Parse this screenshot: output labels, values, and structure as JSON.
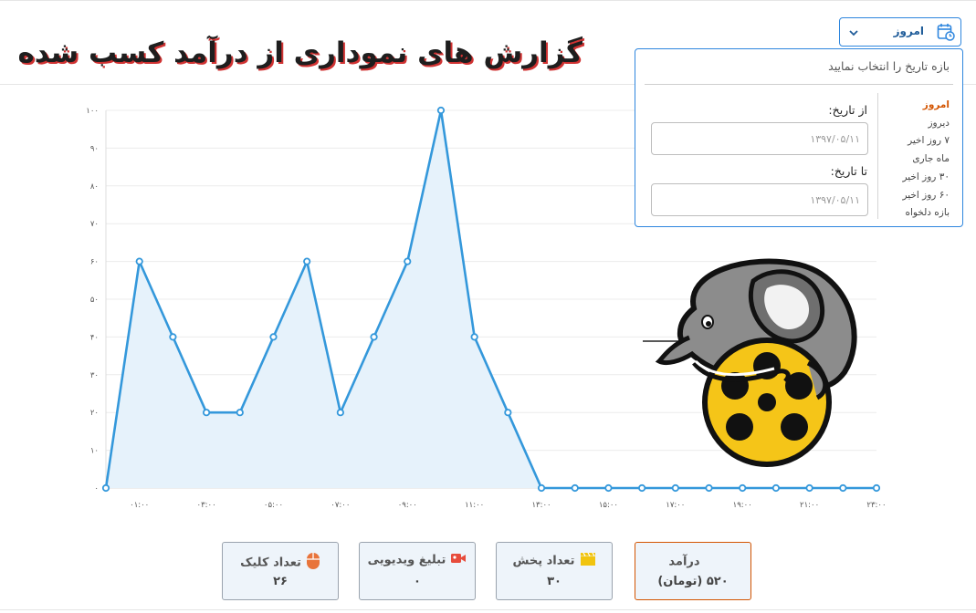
{
  "header": {
    "title": "گزارش های نموداری از درآمد کسب شده"
  },
  "date_range": {
    "selected_label": "امروز",
    "panel_title": "بازه تاریخ را انتخاب نمایید",
    "presets": [
      "امروز",
      "دیروز",
      "۷ روز اخیر",
      "ماه جاری",
      "۳۰ روز اخیر",
      "۶۰ روز اخیر",
      "بازه دلخواه"
    ],
    "active_index": 0,
    "from_label": "از تاریخ:",
    "from_placeholder": "۱۳۹۷/۰۵/۱۱",
    "to_label": "تا تاریخ:",
    "to_placeholder": "۱۳۹۷/۰۵/۱۱"
  },
  "chart_data": {
    "type": "area",
    "x": [
      "۰۰:۰۰",
      "۰۱:۰۰",
      "۰۲:۰۰",
      "۰۳:۰۰",
      "۰۴:۰۰",
      "۰۵:۰۰",
      "۰۶:۰۰",
      "۰۷:۰۰",
      "۰۸:۰۰",
      "۰۹:۰۰",
      "۱۰:۰۰",
      "۱۱:۰۰",
      "۱۲:۰۰",
      "۱۳:۰۰",
      "۱۴:۰۰",
      "۱۵:۰۰",
      "۱۶:۰۰",
      "۱۷:۰۰",
      "۱۸:۰۰",
      "۱۹:۰۰",
      "۲۰:۰۰",
      "۲۱:۰۰",
      "۲۲:۰۰",
      "۲۳:۰۰"
    ],
    "x_tick_labels": [
      "۰۱:۰۰",
      "۰۳:۰۰",
      "۰۵:۰۰",
      "۰۷:۰۰",
      "۰۹:۰۰",
      "۱۱:۰۰",
      "۱۳:۰۰",
      "۱۵:۰۰",
      "۱۷:۰۰",
      "۱۹:۰۰",
      "۲۱:۰۰",
      "۲۳:۰۰"
    ],
    "series": [
      {
        "values": [
          0,
          60,
          40,
          20,
          20,
          40,
          60,
          20,
          40,
          60,
          100,
          40,
          20,
          0,
          0,
          0,
          0,
          0,
          0,
          0,
          0,
          0,
          0,
          0
        ]
      }
    ],
    "ylim": [
      0,
      100
    ],
    "y_ticks": [
      "۰",
      "۱۰",
      "۲۰",
      "۳۰",
      "۴۰",
      "۵۰",
      "۶۰",
      "۷۰",
      "۸۰",
      "۹۰",
      "۱۰۰"
    ],
    "grid": true,
    "colors": {
      "line": "#3498db",
      "fill": "#e6f2fb"
    }
  },
  "stats": [
    {
      "title": "درآمد",
      "value": "۵۲۰ (تومان)",
      "icon": "dollar-icon",
      "color": "#555555"
    },
    {
      "title": "تعداد پخش",
      "value": "۳۰",
      "icon": "clapperboard-icon",
      "color": "#f1c40f"
    },
    {
      "title": "تبلیغ ویدیویی",
      "value": "۰",
      "icon": "video-camera-icon",
      "color": "#e74c3c"
    },
    {
      "title": "تعداد کلیک",
      "value": "۲۶",
      "icon": "mouse-icon",
      "color": "#e8743b"
    }
  ]
}
